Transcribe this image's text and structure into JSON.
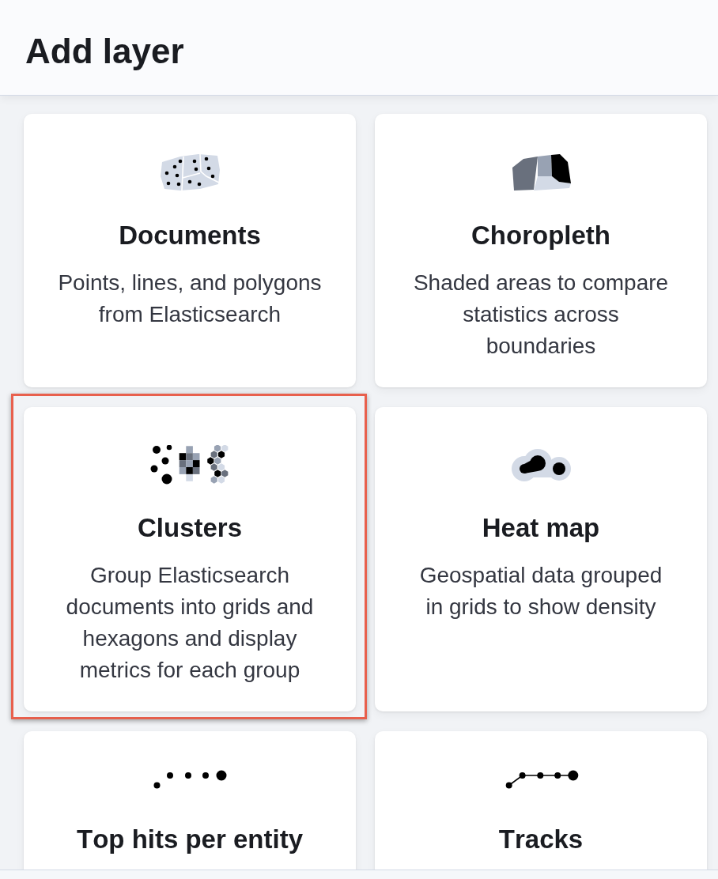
{
  "header": {
    "title": "Add layer"
  },
  "cards": [
    {
      "kind": "documents",
      "title": "Documents",
      "description": "Points, lines, and polygons from Elasticsearch",
      "highlighted": false
    },
    {
      "kind": "choropleth",
      "title": "Choropleth",
      "description": "Shaded areas to compare statistics across boundaries",
      "highlighted": false
    },
    {
      "kind": "clusters",
      "title": "Clusters",
      "description": "Group Elasticsearch documents into grids and hexagons and display metrics for each group",
      "highlighted": true
    },
    {
      "kind": "heatmap",
      "title": "Heat map",
      "description": "Geospatial data grouped in grids to show density",
      "highlighted": false
    },
    {
      "kind": "top_hits",
      "title": "Top hits per entity",
      "highlighted": false
    },
    {
      "kind": "tracks",
      "title": "Tracks",
      "highlighted": false
    }
  ]
}
